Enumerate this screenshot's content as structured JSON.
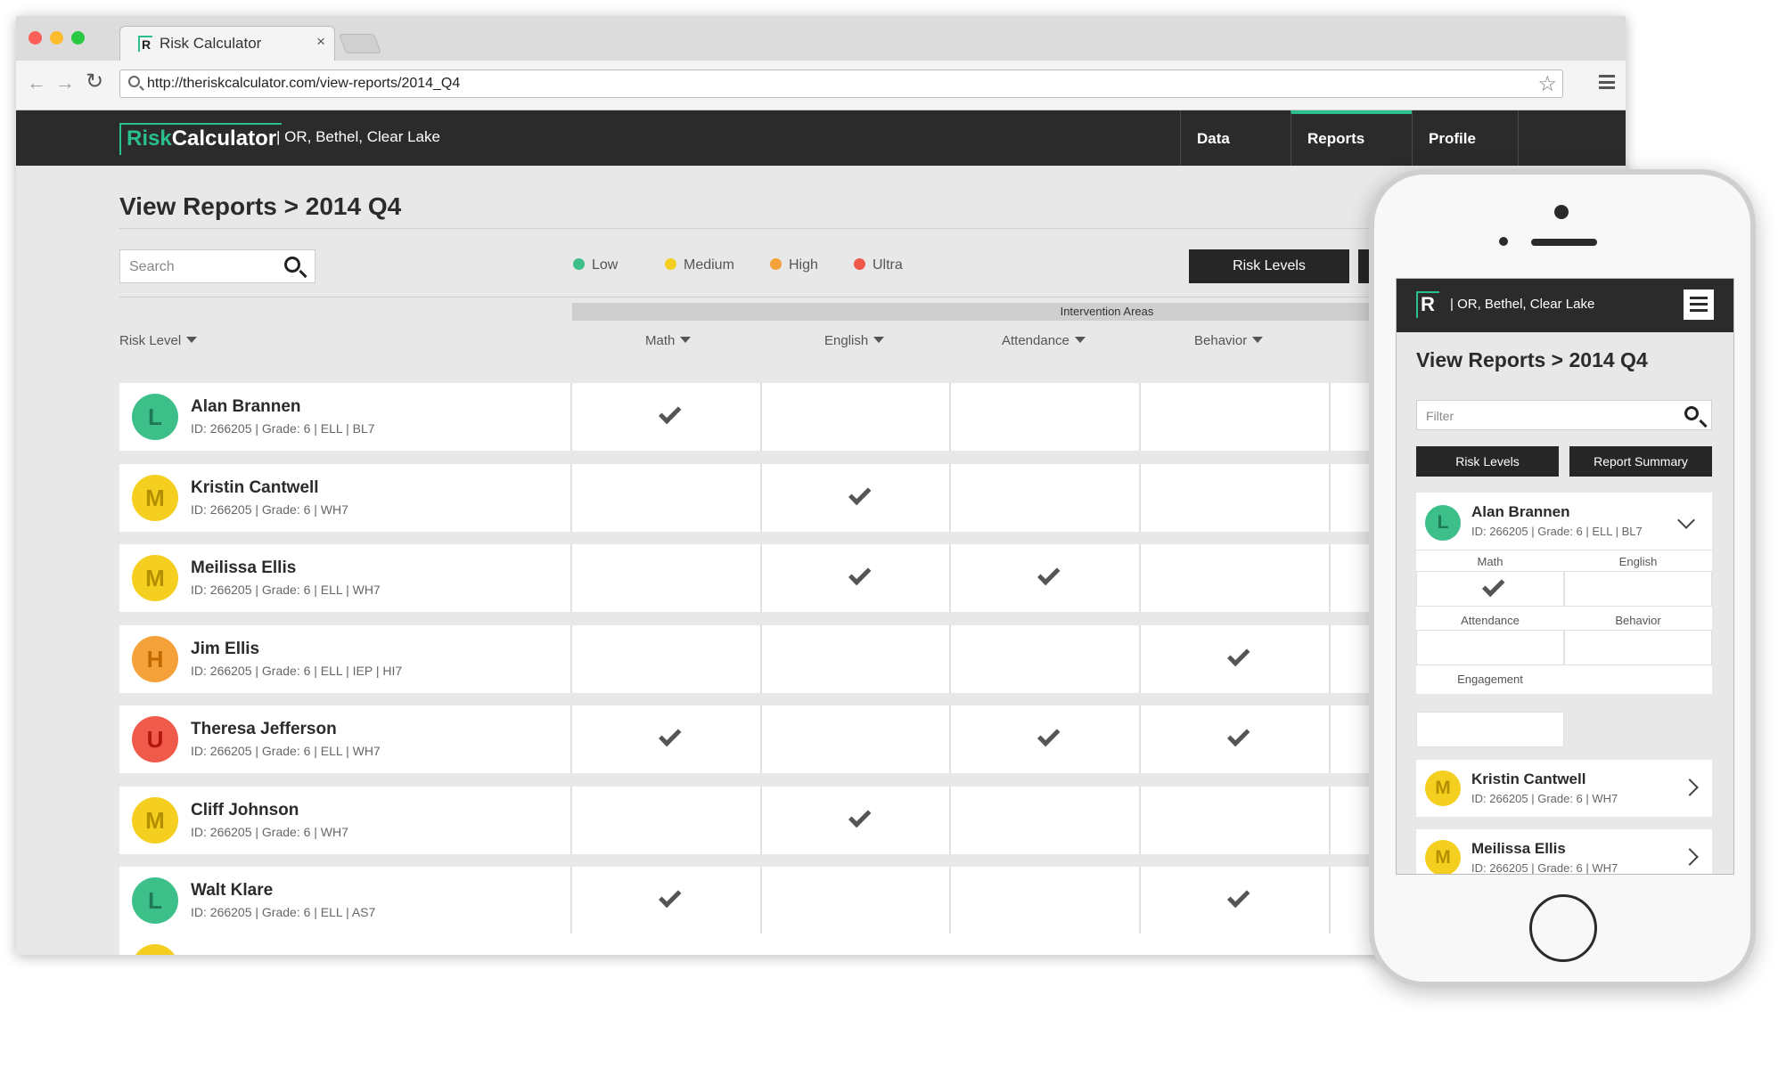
{
  "browser": {
    "tab_title": "Risk Calculator",
    "tab_close": "×",
    "url": "http://theriskcalculator.com/view-reports/2014_Q4"
  },
  "app": {
    "logo_risk": "Risk",
    "logo_calc": "Calculator",
    "location": "|  OR, Bethel, Clear Lake",
    "nav": [
      "Data",
      "Reports",
      "Profile"
    ],
    "active_nav": "Reports"
  },
  "page": {
    "title": "View Reports > 2014 Q4",
    "search_placeholder": "Search",
    "risk_levels_button": "Risk Levels",
    "intervention_areas": "Intervention Areas",
    "risk_level_header": "Risk Level",
    "columns": [
      "Math",
      "English",
      "Attendance",
      "Behavior"
    ]
  },
  "legend": [
    {
      "label": "Low",
      "color": "#3dbf8a"
    },
    {
      "label": "Medium",
      "color": "#f5cf1f"
    },
    {
      "label": "High",
      "color": "#f4a13a"
    },
    {
      "label": "Ultra",
      "color": "#ef5a4a"
    }
  ],
  "students": [
    {
      "initial": "L",
      "name": "Alan Brannen",
      "meta": "ID: 266205  |  Grade: 6  |  ELL  |  BL7",
      "level": "Low",
      "checks": [
        true,
        false,
        false,
        false
      ]
    },
    {
      "initial": "M",
      "name": "Kristin Cantwell",
      "meta": "ID: 266205  |  Grade: 6  |  WH7",
      "level": "Medium",
      "checks": [
        false,
        true,
        false,
        false
      ]
    },
    {
      "initial": "M",
      "name": "Meilissa Ellis",
      "meta": "ID: 266205  |  Grade: 6  |  ELL  |  WH7",
      "level": "Medium",
      "checks": [
        false,
        true,
        true,
        false
      ]
    },
    {
      "initial": "H",
      "name": "Jim Ellis",
      "meta": "ID: 266205  |  Grade: 6  |  ELL  |  IEP  |  HI7",
      "level": "High",
      "checks": [
        false,
        false,
        false,
        true
      ]
    },
    {
      "initial": "U",
      "name": "Theresa Jefferson",
      "meta": "ID: 266205  |  Grade: 6  |  ELL  |  WH7",
      "level": "Ultra",
      "checks": [
        true,
        false,
        true,
        true
      ]
    },
    {
      "initial": "M",
      "name": "Cliff Johnson",
      "meta": "ID: 266205  |  Grade: 6  |  WH7",
      "level": "Medium",
      "checks": [
        false,
        true,
        false,
        false
      ]
    },
    {
      "initial": "L",
      "name": "Walt Klare",
      "meta": "ID: 266205  |  Grade: 6  |  ELL  |  AS7",
      "level": "Low",
      "checks": [
        true,
        false,
        false,
        true
      ]
    }
  ],
  "mobile": {
    "location": "|  OR, Bethel, Clear Lake",
    "logo": "R",
    "title": "View Reports > 2014 Q4",
    "filter_placeholder": "Filter",
    "risk_levels_button": "Risk Levels",
    "report_summary_button": "Report Summary",
    "expanded": {
      "initial": "L",
      "name": "Alan Brannen",
      "meta": "ID: 266205 | Grade: 6 | ELL | BL7",
      "areas": [
        "Math",
        "English",
        "Attendance",
        "Behavior",
        "Engagement"
      ]
    },
    "cards": [
      {
        "initial": "M",
        "name": "Kristin Cantwell",
        "meta": "ID: 266205 | Grade: 6 | WH7"
      },
      {
        "initial": "M",
        "name": "Meilissa Ellis",
        "meta": "ID: 266205 | Grade: 6 | WH7"
      }
    ]
  }
}
